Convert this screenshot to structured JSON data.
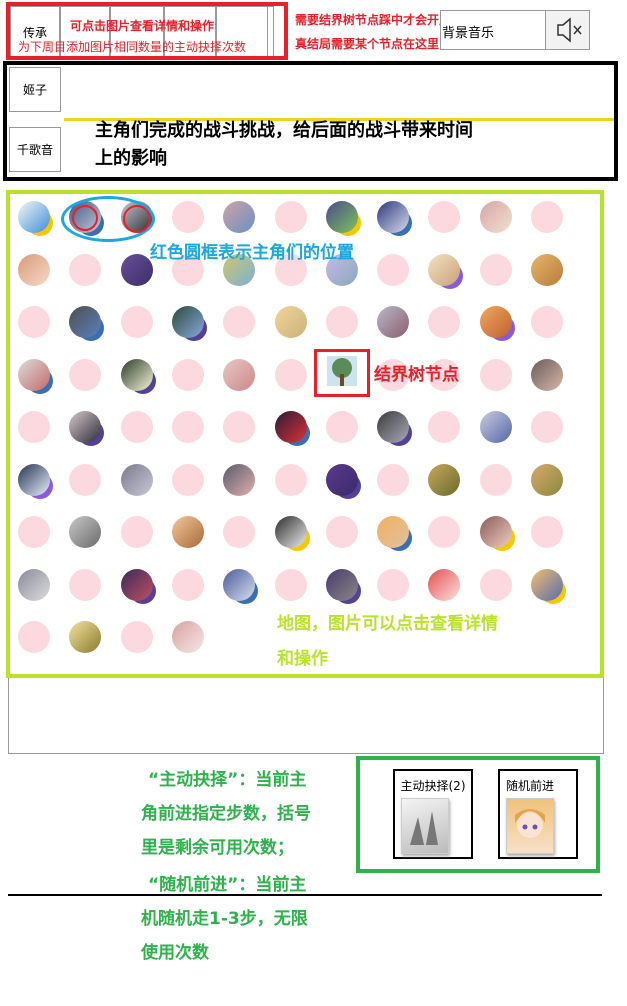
{
  "top": {
    "chuancheng": "传承",
    "red_title": "可点击图片查看详情和操作",
    "red_sub": "为下周目添加图片相同数量的主动抉择次数",
    "note_line1": "需要结界树节点踩中才会开启功能",
    "note_line2": "真结局需要某个节点在这里",
    "music_label": "背景音乐",
    "mute_icon": "speaker-mute-icon"
  },
  "characters": {
    "items": [
      {
        "label": "姬子"
      },
      {
        "label": "千歌音"
      }
    ],
    "info": "主角们完成的战斗挑战，给后面的战斗带来时间上的影响"
  },
  "map": {
    "position_note": "红色圆框表示主角们的位置",
    "tree_note": "结界树节点",
    "map_note_line1": "地图，图片可以点击查看详情",
    "map_note_line2": "和操作"
  },
  "skills": {
    "active": {
      "label": "主动抉择(2)"
    },
    "random": {
      "label": "随机前进"
    },
    "desc_line1": "“主动抉择”：当前主",
    "desc_line2": "角前进指定步数，括号",
    "desc_line3": "里是剩余可用次数；",
    "desc_line4": "“随机前进”：当前主",
    "desc_line5": "机随机走1-3步，无限",
    "desc_line6": "使用次数"
  },
  "colors": {
    "red": "#e8202a",
    "black": "#000000",
    "lime": "#b9e32a",
    "green": "#2fb24c",
    "blue": "#1aa7e2",
    "pink_dot": "#fcd9de"
  }
}
